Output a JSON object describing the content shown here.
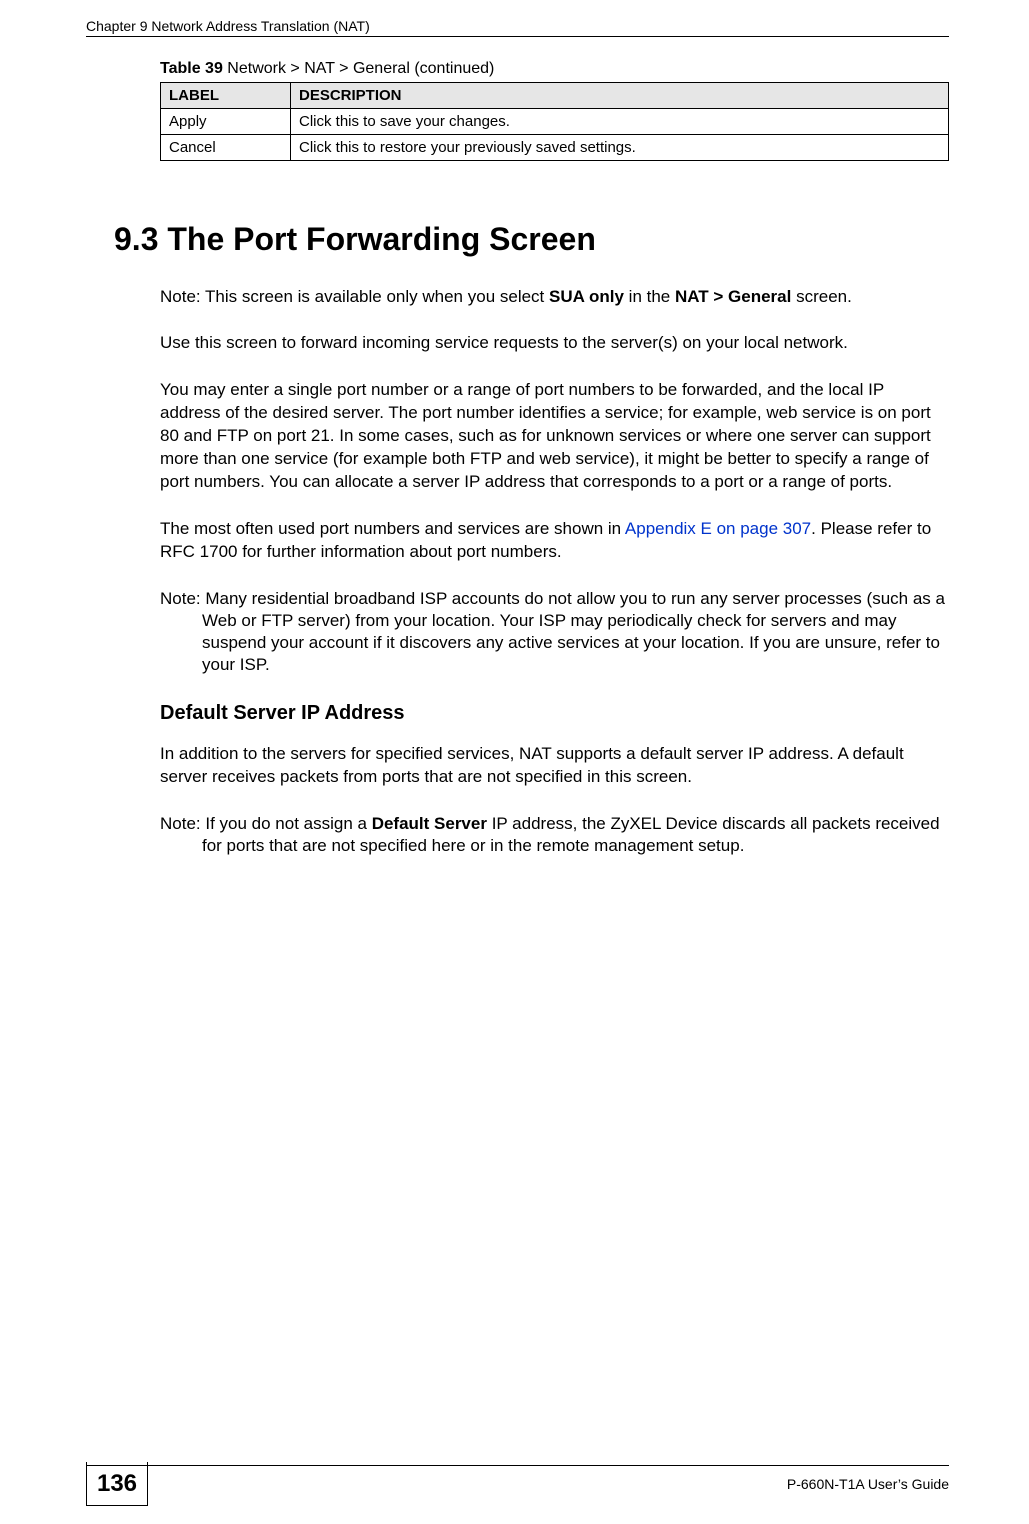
{
  "header": {
    "chapter_line": "Chapter 9 Network Address Translation (NAT)"
  },
  "table": {
    "caption_bold": "Table 39",
    "caption_rest": "   Network > NAT > General (continued)",
    "headers": [
      "LABEL",
      "DESCRIPTION"
    ],
    "rows": [
      {
        "label": "Apply",
        "desc": "Click this to save your changes."
      },
      {
        "label": "Cancel",
        "desc": "Click this to restore your previously saved settings."
      }
    ]
  },
  "section": {
    "heading": "9.3  The Port Forwarding Screen",
    "note1_prefix": "Note: This screen is available only when you select ",
    "note1_b1": "SUA only",
    "note1_mid": " in the ",
    "note1_b2": "NAT > General",
    "note1_suffix": " screen.",
    "p1": "Use this screen to forward incoming service requests to the server(s) on your local network.",
    "p2": "You may enter a single port number or a range of port numbers to be forwarded, and the local IP address of the desired server. The port number identifies a service; for example, web service is on port 80 and FTP on port 21. In some cases, such as for unknown services or where one server can support more than one service (for example both FTP and web service), it might be better to specify a range of port numbers. You can allocate a server IP address that corresponds to a port or a range of ports.",
    "p3_pre": "The most often used port numbers and services are shown in ",
    "p3_link": "Appendix E on page 307",
    "p3_post": ". Please refer to RFC 1700 for further information about port numbers.",
    "note2": "Note: Many residential broadband ISP accounts do not allow you to run any server processes (such as a Web or FTP server) from your location. Your ISP may periodically check for servers and may suspend your account if it discovers any active services at your location. If you are unsure, refer to your ISP.",
    "subheading": "Default Server IP Address",
    "p4": "In addition to the servers for specified services, NAT supports a default server IP address. A default server receives packets from ports that are not specified in this screen.",
    "note3_prefix": "Note: If you do not assign a ",
    "note3_b1": "Default Server",
    "note3_suffix": " IP address, the ZyXEL Device discards all packets received for ports that are not specified here or in the remote management setup."
  },
  "footer": {
    "page_num": "136",
    "guide": "P-660N-T1A User’s Guide"
  }
}
